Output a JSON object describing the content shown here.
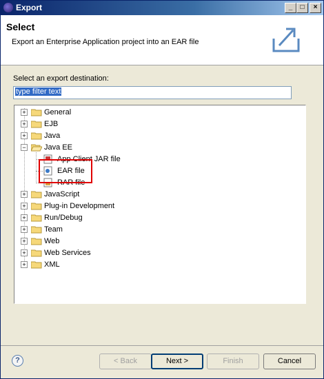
{
  "window": {
    "title": "Export"
  },
  "header": {
    "title": "Select",
    "description": "Export an Enterprise Application project into an EAR file"
  },
  "destination_label": "Select an export destination:",
  "filter": {
    "value": "type filter text"
  },
  "tree": {
    "items": [
      {
        "label": "General"
      },
      {
        "label": "EJB"
      },
      {
        "label": "Java"
      },
      {
        "label": "Java EE"
      },
      {
        "label": "App Client JAR file"
      },
      {
        "label": "EAR file"
      },
      {
        "label": "RAR file"
      },
      {
        "label": "JavaScript"
      },
      {
        "label": "Plug-in Development"
      },
      {
        "label": "Run/Debug"
      },
      {
        "label": "Team"
      },
      {
        "label": "Web"
      },
      {
        "label": "Web Services"
      },
      {
        "label": "XML"
      }
    ]
  },
  "buttons": {
    "back": "< Back",
    "next": "Next >",
    "finish": "Finish",
    "cancel": "Cancel"
  },
  "colors": {
    "titlebar": "#0a246a",
    "highlight_box": "#e00000",
    "selection": "#316ac5"
  }
}
